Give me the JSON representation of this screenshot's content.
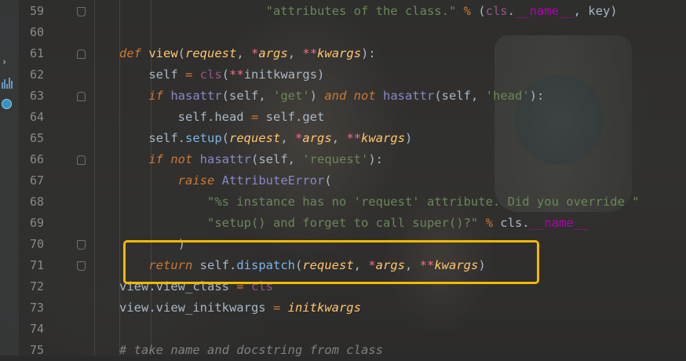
{
  "editor": {
    "lines": [
      {
        "n": "59",
        "tokens": [
          {
            "t": "                    ",
            "c": "txt"
          },
          {
            "t": "\"attributes of the class.\"",
            "c": "str"
          },
          {
            "t": " ",
            "c": "txt"
          },
          {
            "t": "%",
            "c": "op"
          },
          {
            "t": " (",
            "c": "txt"
          },
          {
            "t": "cls",
            "c": "cls"
          },
          {
            "t": ".",
            "c": "txt"
          },
          {
            "t": "__name__",
            "c": "dunder"
          },
          {
            "t": ", key)",
            "c": "txt"
          }
        ]
      },
      {
        "n": "60",
        "tokens": []
      },
      {
        "n": "61",
        "tokens": [
          {
            "t": "def",
            "c": "kw"
          },
          {
            "t": " ",
            "c": "txt"
          },
          {
            "t": "view",
            "c": "fn"
          },
          {
            "t": "(",
            "c": "txt"
          },
          {
            "t": "request",
            "c": "param"
          },
          {
            "t": ", ",
            "c": "txt"
          },
          {
            "t": "*",
            "c": "star"
          },
          {
            "t": "args",
            "c": "param"
          },
          {
            "t": ", ",
            "c": "txt"
          },
          {
            "t": "**",
            "c": "star"
          },
          {
            "t": "kwargs",
            "c": "param"
          },
          {
            "t": "):",
            "c": "txt"
          }
        ]
      },
      {
        "n": "62",
        "tokens": [
          {
            "t": "    self ",
            "c": "txt"
          },
          {
            "t": "=",
            "c": "op"
          },
          {
            "t": " ",
            "c": "txt"
          },
          {
            "t": "cls",
            "c": "cls"
          },
          {
            "t": "(",
            "c": "txt"
          },
          {
            "t": "**",
            "c": "star"
          },
          {
            "t": "initkwargs)",
            "c": "txt"
          }
        ]
      },
      {
        "n": "63",
        "tokens": [
          {
            "t": "    ",
            "c": "txt"
          },
          {
            "t": "if",
            "c": "kw"
          },
          {
            "t": " ",
            "c": "txt"
          },
          {
            "t": "hasattr",
            "c": "builtin"
          },
          {
            "t": "(self, ",
            "c": "txt"
          },
          {
            "t": "'get'",
            "c": "str"
          },
          {
            "t": ") ",
            "c": "txt"
          },
          {
            "t": "and not",
            "c": "kw"
          },
          {
            "t": " ",
            "c": "txt"
          },
          {
            "t": "hasattr",
            "c": "builtin"
          },
          {
            "t": "(self, ",
            "c": "txt"
          },
          {
            "t": "'head'",
            "c": "str"
          },
          {
            "t": "):",
            "c": "txt"
          }
        ]
      },
      {
        "n": "64",
        "tokens": [
          {
            "t": "        self.head ",
            "c": "txt"
          },
          {
            "t": "=",
            "c": "op"
          },
          {
            "t": " self.get",
            "c": "txt"
          }
        ]
      },
      {
        "n": "65",
        "tokens": [
          {
            "t": "    self.",
            "c": "txt"
          },
          {
            "t": "setup",
            "c": "meth"
          },
          {
            "t": "(",
            "c": "txt"
          },
          {
            "t": "request",
            "c": "param"
          },
          {
            "t": ", ",
            "c": "txt"
          },
          {
            "t": "*",
            "c": "star"
          },
          {
            "t": "args",
            "c": "param"
          },
          {
            "t": ", ",
            "c": "txt"
          },
          {
            "t": "**",
            "c": "star"
          },
          {
            "t": "kwargs",
            "c": "param"
          },
          {
            "t": ")",
            "c": "txt"
          }
        ]
      },
      {
        "n": "66",
        "tokens": [
          {
            "t": "    ",
            "c": "txt"
          },
          {
            "t": "if not",
            "c": "kw"
          },
          {
            "t": " ",
            "c": "txt"
          },
          {
            "t": "hasattr",
            "c": "builtin"
          },
          {
            "t": "(self, ",
            "c": "txt"
          },
          {
            "t": "'request'",
            "c": "str"
          },
          {
            "t": "):",
            "c": "txt"
          }
        ]
      },
      {
        "n": "67",
        "tokens": [
          {
            "t": "        ",
            "c": "txt"
          },
          {
            "t": "raise",
            "c": "kw"
          },
          {
            "t": " ",
            "c": "txt"
          },
          {
            "t": "AttributeError",
            "c": "builtin"
          },
          {
            "t": "(",
            "c": "txt"
          }
        ]
      },
      {
        "n": "68",
        "tokens": [
          {
            "t": "            ",
            "c": "txt"
          },
          {
            "t": "\"%s instance has no 'request' attribute. Did you override \"",
            "c": "str"
          }
        ]
      },
      {
        "n": "69",
        "tokens": [
          {
            "t": "            ",
            "c": "txt"
          },
          {
            "t": "\"setup() and forget to call super()?\"",
            "c": "str"
          },
          {
            "t": " ",
            "c": "txt"
          },
          {
            "t": "%",
            "c": "op"
          },
          {
            "t": " cls.",
            "c": "txt"
          },
          {
            "t": "__name__",
            "c": "dunder"
          }
        ]
      },
      {
        "n": "70",
        "tokens": [
          {
            "t": "        )",
            "c": "txt"
          }
        ]
      },
      {
        "n": "71",
        "tokens": [
          {
            "t": "    ",
            "c": "txt"
          },
          {
            "t": "return",
            "c": "kw"
          },
          {
            "t": " self.",
            "c": "txt"
          },
          {
            "t": "dispatch",
            "c": "meth"
          },
          {
            "t": "(",
            "c": "txt"
          },
          {
            "t": "request",
            "c": "param"
          },
          {
            "t": ", ",
            "c": "txt"
          },
          {
            "t": "*",
            "c": "star"
          },
          {
            "t": "args",
            "c": "param"
          },
          {
            "t": ", ",
            "c": "txt"
          },
          {
            "t": "**",
            "c": "star"
          },
          {
            "t": "kwargs",
            "c": "param"
          },
          {
            "t": ")",
            "c": "txt"
          }
        ]
      },
      {
        "n": "72",
        "tokens": [
          {
            "t": "view.view_class ",
            "c": "txt"
          },
          {
            "t": "=",
            "c": "op"
          },
          {
            "t": " ",
            "c": "txt"
          },
          {
            "t": "cls",
            "c": "cls"
          }
        ]
      },
      {
        "n": "73",
        "tokens": [
          {
            "t": "view.view_initkwargs ",
            "c": "txt"
          },
          {
            "t": "=",
            "c": "op"
          },
          {
            "t": " ",
            "c": "txt"
          },
          {
            "t": "initkwargs",
            "c": "param"
          }
        ]
      },
      {
        "n": "74",
        "tokens": []
      },
      {
        "n": "75",
        "tokens": [
          {
            "t": "# take name and docstring from class",
            "c": "cmt"
          }
        ]
      }
    ]
  },
  "colors": {
    "highlight_border": "#f5b800",
    "background": "#2b2b2b"
  }
}
